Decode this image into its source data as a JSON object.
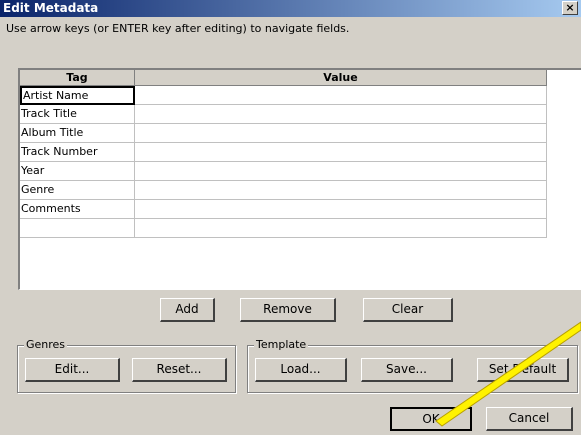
{
  "window": {
    "title": "Edit Metadata",
    "close_glyph": "×"
  },
  "instruction": "Use arrow keys (or ENTER key after editing) to navigate fields.",
  "table": {
    "columns": [
      "Tag",
      "Value"
    ],
    "rows": [
      {
        "tag": "Artist Name",
        "value": ""
      },
      {
        "tag": "Track Title",
        "value": ""
      },
      {
        "tag": "Album Title",
        "value": ""
      },
      {
        "tag": "Track Number",
        "value": ""
      },
      {
        "tag": "Year",
        "value": ""
      },
      {
        "tag": "Genre",
        "value": ""
      },
      {
        "tag": "Comments",
        "value": ""
      },
      {
        "tag": "",
        "value": ""
      }
    ]
  },
  "row_buttons": {
    "add": "Add",
    "remove": "Remove",
    "clear": "Clear"
  },
  "genres": {
    "label": "Genres",
    "edit": "Edit...",
    "reset": "Reset..."
  },
  "template": {
    "label": "Template",
    "load": "Load...",
    "save": "Save...",
    "set_default": "Set Default"
  },
  "dialog_buttons": {
    "ok": "OK",
    "cancel": "Cancel"
  }
}
